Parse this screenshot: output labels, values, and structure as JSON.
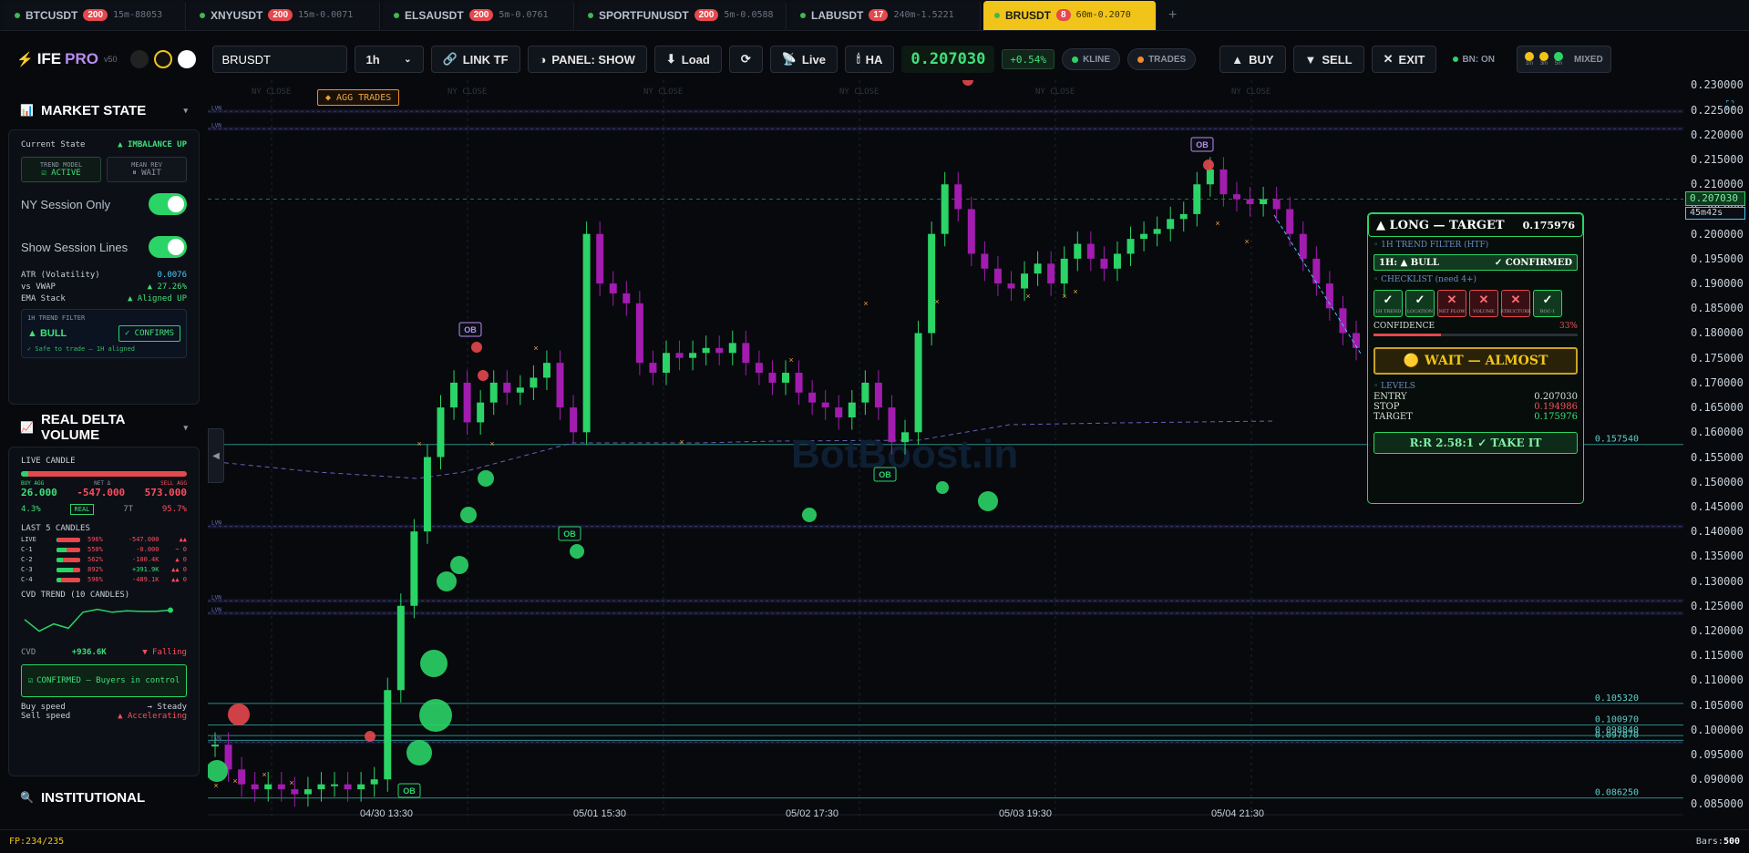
{
  "tabs": [
    {
      "symbol": "BTCUSDT",
      "badge": "200",
      "sub": "15m-88053"
    },
    {
      "symbol": "XNYUSDT",
      "badge": "200",
      "sub": "15m-0.0071"
    },
    {
      "symbol": "ELSAUSDT",
      "badge": "200",
      "sub": "5m-0.0761"
    },
    {
      "symbol": "SPORTFUNUSDT",
      "badge": "200",
      "sub": "5m-0.0588"
    },
    {
      "symbol": "LABUSDT",
      "badge": "17",
      "sub": "240m-1.5221"
    },
    {
      "symbol": "BRUSDT",
      "badge": "8",
      "sub": "60m-0.2070",
      "active": true
    }
  ],
  "tab_add": "+",
  "toolbar": {
    "logo_a": "IFE",
    "logo_b": "PRO",
    "logo_ver": "v50",
    "symbol": "BRUSDT",
    "timeframe": "1h",
    "link_tf": "LINK TF",
    "panel": "PANEL: SHOW",
    "load": "Load",
    "live": "Live",
    "ha": "HA",
    "price": "0.207030",
    "pct": "+0.54%",
    "kline": "KLINE",
    "trades": "TRADES",
    "buy": "BUY",
    "sell": "SELL",
    "exit": "EXIT",
    "bn": "BN: ON",
    "tf_labels": [
      "1m",
      "3m",
      "5m"
    ],
    "mixed": "MIXED"
  },
  "market_state": {
    "title": "MARKET STATE",
    "current_state_label": "Current State",
    "current_state": "▲ IMBALANCE UP",
    "trend_model_label": "TREND MODEL",
    "trend_model": "ACTIVE",
    "mean_rev_label": "MEAN REV",
    "mean_rev": "WAIT",
    "ny_session": "NY Session Only",
    "session_lines": "Show Session Lines",
    "atr_label": "ATR (Volatility)",
    "atr": "0.0076",
    "vwap_label": "vs VWAP",
    "vwap": "▲ 27.26%",
    "ema_label": "EMA Stack",
    "ema": "▲ Aligned UP",
    "filter_label": "1H TREND FILTER",
    "filter_bull": "▲ BULL",
    "filter_confirms": "✓ CONFIRMS",
    "filter_note": "✓ Safe to trade — 1H aligned"
  },
  "delta": {
    "title": "REAL DELTA VOLUME",
    "live_candle": "LIVE CANDLE",
    "buy_label": "BUY AGG",
    "net_label": "NET Δ",
    "sell_label": "SELL AGG",
    "buy": "26.000",
    "net": "-547.000",
    "sell": "573.000",
    "buy_pct_text": "4.3%",
    "real": "REAL",
    "trades": "7T",
    "sell_pct_text": "95.7%",
    "buy_fraction": 0.043,
    "last5_label": "LAST 5 CANDLES",
    "rows": [
      {
        "name": "LIVE",
        "pct": "596%",
        "val": "-547.000",
        "arrows": "▲▲",
        "buy_fraction": 0.04
      },
      {
        "name": "C-1",
        "pct": "550%",
        "val": "-0.000",
        "arrows": "~ 0",
        "buy_fraction": 0.45
      },
      {
        "name": "C-2",
        "pct": "562%",
        "val": "-100.4K",
        "arrows": "▲ 0",
        "buy_fraction": 0.3
      },
      {
        "name": "C-3",
        "pct": "892%",
        "val": "+391.9K",
        "arrows": "▲▲ 0",
        "buy_fraction": 0.7
      },
      {
        "name": "C-4",
        "pct": "596%",
        "val": "-489.1K",
        "arrows": "▲▲ 0",
        "buy_fraction": 0.2
      }
    ],
    "cvd_trend_label": "CVD TREND (10 CANDLES)",
    "cvd_values": [
      0.6,
      0.2,
      0.45,
      0.3,
      0.85,
      0.95,
      0.85,
      0.9,
      0.88,
      0.88,
      0.92
    ],
    "cvd_label": "CVD",
    "cvd": "+936.6K",
    "cvd_status": "▼ Falling",
    "confirmed": "CONFIRMED — Buyers in control",
    "buy_speed_label": "Buy speed",
    "buy_speed": "→ Steady",
    "sell_speed_label": "Sell speed",
    "sell_speed": "▲ Accelerating"
  },
  "institutional": {
    "title": "INSTITUTIONAL"
  },
  "chart": {
    "session_label": "NY CLOSE",
    "agg_trades": "◆ AGG TRADES",
    "x_labels": [
      "04/30 13:30",
      "05/01 15:30",
      "05/02 17:30",
      "05/03 19:30",
      "05/04 21:30"
    ],
    "y_ticks": [
      "0.230000",
      "0.225000",
      "0.220000",
      "0.215000",
      "0.210000",
      "0.205000",
      "0.200000",
      "0.195000",
      "0.190000",
      "0.185000",
      "0.180000",
      "0.175000",
      "0.170000",
      "0.165000",
      "0.160000",
      "0.155000",
      "0.150000",
      "0.145000",
      "0.140000",
      "0.135000",
      "0.130000",
      "0.125000",
      "0.120000",
      "0.115000",
      "0.110000",
      "0.105000",
      "0.100000",
      "0.095000",
      "0.090000",
      "0.085000"
    ],
    "y_range": [
      0.0825,
      0.231
    ],
    "price_tag": "0.207030",
    "timer_tag": "45m42s",
    "lvn": "LVN",
    "ob": "OB",
    "level_labels": [
      "0.157540",
      "0.105320",
      "0.100970",
      "0.098840",
      "0.097870",
      "0.086250"
    ],
    "watermark": "BotBoost.in"
  },
  "chart_data": {
    "type": "candlestick",
    "title": "",
    "xlabel": "",
    "ylabel": "",
    "x": [
      "04/30 13:30",
      "05/01 15:30",
      "05/02 17:30",
      "05/03 19:30",
      "05/04 21:30"
    ],
    "ylim": [
      0.0825,
      0.231
    ],
    "last_price": 0.20703,
    "levels": [
      0.15754,
      0.10532,
      0.10097,
      0.09884,
      0.09787,
      0.08625
    ],
    "close_path": [
      0.097,
      0.092,
      0.089,
      0.088,
      0.089,
      0.088,
      0.087,
      0.088,
      0.089,
      0.089,
      0.088,
      0.089,
      0.09,
      0.108,
      0.125,
      0.14,
      0.155,
      0.165,
      0.17,
      0.162,
      0.166,
      0.17,
      0.168,
      0.169,
      0.171,
      0.174,
      0.165,
      0.16,
      0.2,
      0.19,
      0.188,
      0.186,
      0.174,
      0.172,
      0.176,
      0.175,
      0.176,
      0.177,
      0.176,
      0.178,
      0.174,
      0.172,
      0.17,
      0.172,
      0.168,
      0.166,
      0.165,
      0.163,
      0.166,
      0.17,
      0.165,
      0.158,
      0.16,
      0.18,
      0.2,
      0.21,
      0.205,
      0.196,
      0.193,
      0.19,
      0.189,
      0.192,
      0.194,
      0.19,
      0.195,
      0.198,
      0.195,
      0.193,
      0.196,
      0.199,
      0.2,
      0.201,
      0.203,
      0.204,
      0.21,
      0.213,
      0.208,
      0.207,
      0.206,
      0.207,
      0.205,
      0.2,
      0.195,
      0.19,
      0.185,
      0.18,
      0.177
    ]
  },
  "card": {
    "title": "▲ LONG — TARGET",
    "target_head": "0.175976",
    "htf_label": "◦ 1H TREND FILTER (HTF)",
    "htf": "1H: ▲ BULL",
    "htf_confirmed": "✓ CONFIRMED",
    "checklist_label": "◦ CHECKLIST (need 4+)",
    "checks": [
      {
        "name": "1H TREND",
        "ok": true
      },
      {
        "name": "LOCATION",
        "ok": true
      },
      {
        "name": "NET FLOW",
        "ok": false
      },
      {
        "name": "VOLUME",
        "ok": false
      },
      {
        "name": "STRUCTURE",
        "ok": false
      },
      {
        "name": "ROC-1",
        "ok": true
      }
    ],
    "confidence_label": "CONFIDENCE",
    "confidence": "33%",
    "confidence_value": 0.33,
    "wait": "WAIT — ALMOST",
    "levels_label": "◦ LEVELS",
    "entry_label": "ENTRY",
    "entry": "0.207030",
    "stop_label": "STOP",
    "stop": "0.194986",
    "target_label": "TARGET",
    "target": "0.175976",
    "rr": "R:R  2.58:1  ✓ TAKE IT"
  },
  "status": {
    "fp": "FP:234/235",
    "bars_label": "Bars:",
    "bars": "500"
  },
  "colors": {
    "bull": "#2bd466",
    "bear": "#a21caf",
    "accent": "#f0c419",
    "sell": "#e5484d"
  }
}
